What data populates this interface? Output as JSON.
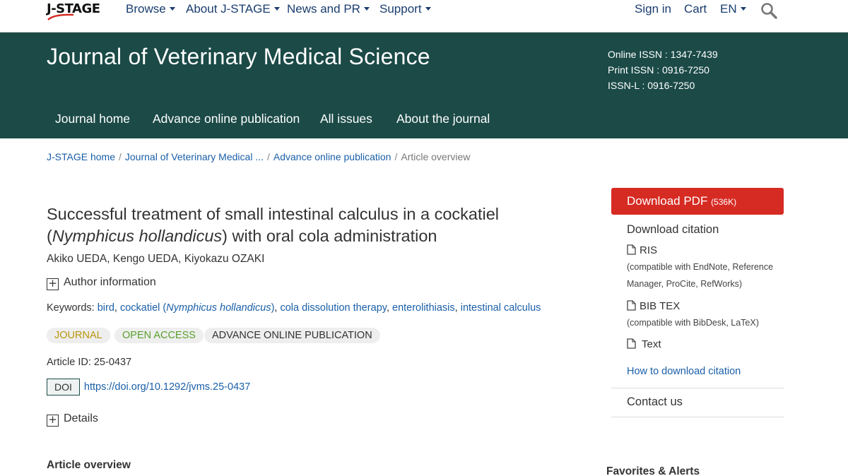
{
  "topnav": {
    "logo_text": "J-STAGE",
    "items": [
      {
        "label": "Browse"
      },
      {
        "label": "About J-STAGE"
      },
      {
        "label": "News and PR"
      },
      {
        "label": "Support"
      }
    ],
    "right": {
      "signin": "Sign in",
      "cart": "Cart",
      "lang": "EN"
    }
  },
  "banner": {
    "title": "Journal of Veterinary Medical Science",
    "issn_online": "Online ISSN : 1347-7439",
    "issn_print": "Print ISSN : 0916-7250",
    "issn_l": "ISSN-L : 0916-7250",
    "tabs": [
      {
        "label": "Journal home"
      },
      {
        "label": "Advance online publication"
      },
      {
        "label": "All issues"
      },
      {
        "label": "About the journal"
      }
    ],
    "color": "#1b4a47"
  },
  "breadcrumb": [
    {
      "label": "J-STAGE home"
    },
    {
      "label": "Journal of Veterinary Medical ..."
    },
    {
      "label": "Advance online publication"
    },
    {
      "label": "Article overview"
    }
  ],
  "article": {
    "title_part1": "Successful treatment of small intestinal calculus in a cockatiel (",
    "title_italic": "Nymphicus hollandicus",
    "title_part2": ") with oral cola administration",
    "authors": "Akiko UEDA, Kengo UEDA, Kiyokazu OZAKI",
    "author_info": "Author information",
    "keywords_label": "Keywords:",
    "keywords": {
      "k1": "bird",
      "k2_pre": "cockatiel (",
      "k2_italic": "Nymphicus hollandicus",
      "k2_post": ")",
      "k3": "cola dissolution therapy",
      "k4": "enterolithiasis",
      "k5": "intestinal calculus"
    },
    "tags": {
      "journal": "JOURNAL",
      "open_access": "OPEN ACCESS",
      "aop": "ADVANCE ONLINE PUBLICATION"
    },
    "article_id": "Article ID: 25-0437",
    "doi_label": "DOI",
    "doi_url": "https://doi.org/10.1292/jvms.25-0437",
    "details": "Details",
    "overview_heading": "Article overview"
  },
  "sidebar": {
    "pdf_label": "Download PDF",
    "pdf_size": "(536K)",
    "pdf_color": "#d62b23",
    "citation_heading": "Download citation",
    "ris_label": "RIS",
    "ris_note": "(compatible with EndNote, Reference Manager, ProCite, RefWorks)",
    "bibtex_label": "BIB TEX",
    "bibtex_note": "(compatible with BibDesk, LaTeX)",
    "text_label": "Text",
    "howto": "How to download citation",
    "contact": "Contact us",
    "favorites": "Favorites & Alerts"
  }
}
